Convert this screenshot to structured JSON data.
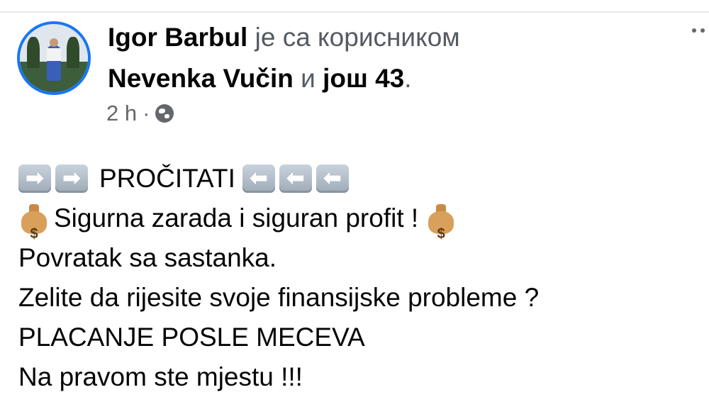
{
  "post": {
    "author": "Igor Barbul",
    "with_text": "је са корисником",
    "tagged": "Nevenka Vučin",
    "and_text": "и",
    "others": "још 43",
    "period": ".",
    "time": "2 h",
    "dot": "·",
    "privacy_icon": "globe-icon",
    "more_icon": "more-options-icon"
  },
  "body": {
    "arrow_right": "➡",
    "arrow_left": "⬅",
    "moneybag_icon": "moneybag-icon",
    "line1_text": "PROČITATI",
    "line2_text": "Sigurna zarada i siguran profit !",
    "line3": "Povratak sa sastanka.",
    "line4": "Zelite da rijesite svoje finansijske probleme ?",
    "line5": "PLACANJE POSLE MECEVA",
    "line6": "Na pravom ste mjestu !!!"
  }
}
